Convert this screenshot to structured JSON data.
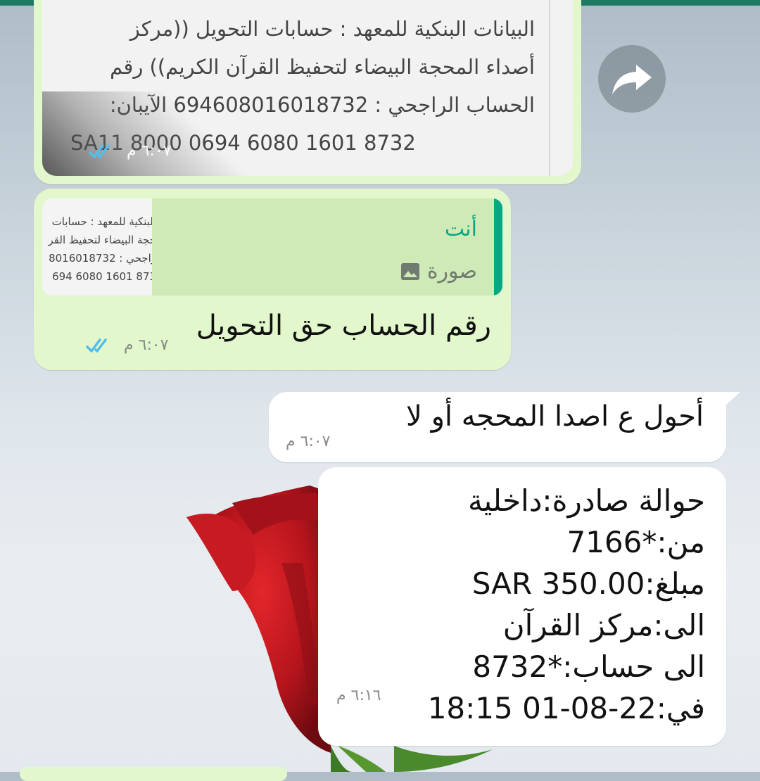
{
  "colors": {
    "header_green": "#1f7a64",
    "outgoing_bubble": "#e2f7cb",
    "incoming_bubble": "#ffffff",
    "quote_accent": "#06a884",
    "read_ticks": "#53bdeb"
  },
  "forward_button": {
    "icon": "share-arrow-icon"
  },
  "messages": [
    {
      "type": "image",
      "direction": "outgoing",
      "image_lines": [
        "البيانات البنكية للمعهد : حسابات التحويل ((مركز",
        "أصداء المحجة البيضاء لتحفيظ القرآن الكريم)) رقم",
        "الحساب الراجحي : 694608016018732 الآيبان:",
        "SA11 8000 0694 6080 1601 8732"
      ],
      "time": "٦:٠٧ م",
      "status_icon": "double-check-read-icon"
    },
    {
      "type": "reply",
      "direction": "outgoing",
      "quote": {
        "author": "أنت",
        "kind_icon": "image-icon",
        "kind": "صورة",
        "thumb_lines": [
          "البنكية للمعهد : حسابات",
          "حجة البيضاء لتحفيظ القر",
          "راجحي : 8016018732",
          "694 6080 1601 873"
        ]
      },
      "text": "رقم الحساب حق التحويل",
      "time": "٦:٠٧ م",
      "status_icon": "double-check-read-icon"
    },
    {
      "type": "text",
      "direction": "incoming",
      "text": "أحول ع اصدا المحجه أو لا",
      "time": "٦:٠٧ م"
    },
    {
      "type": "text",
      "direction": "incoming",
      "lines": [
        "حوالة صادرة:داخلية",
        "من:*7166",
        "مبلغ:SAR 350.00",
        "الى:مركز القرآن",
        "الى حساب:*8732",
        "في:22-08-01 18:15"
      ],
      "time": "٦:١٦ م"
    }
  ]
}
